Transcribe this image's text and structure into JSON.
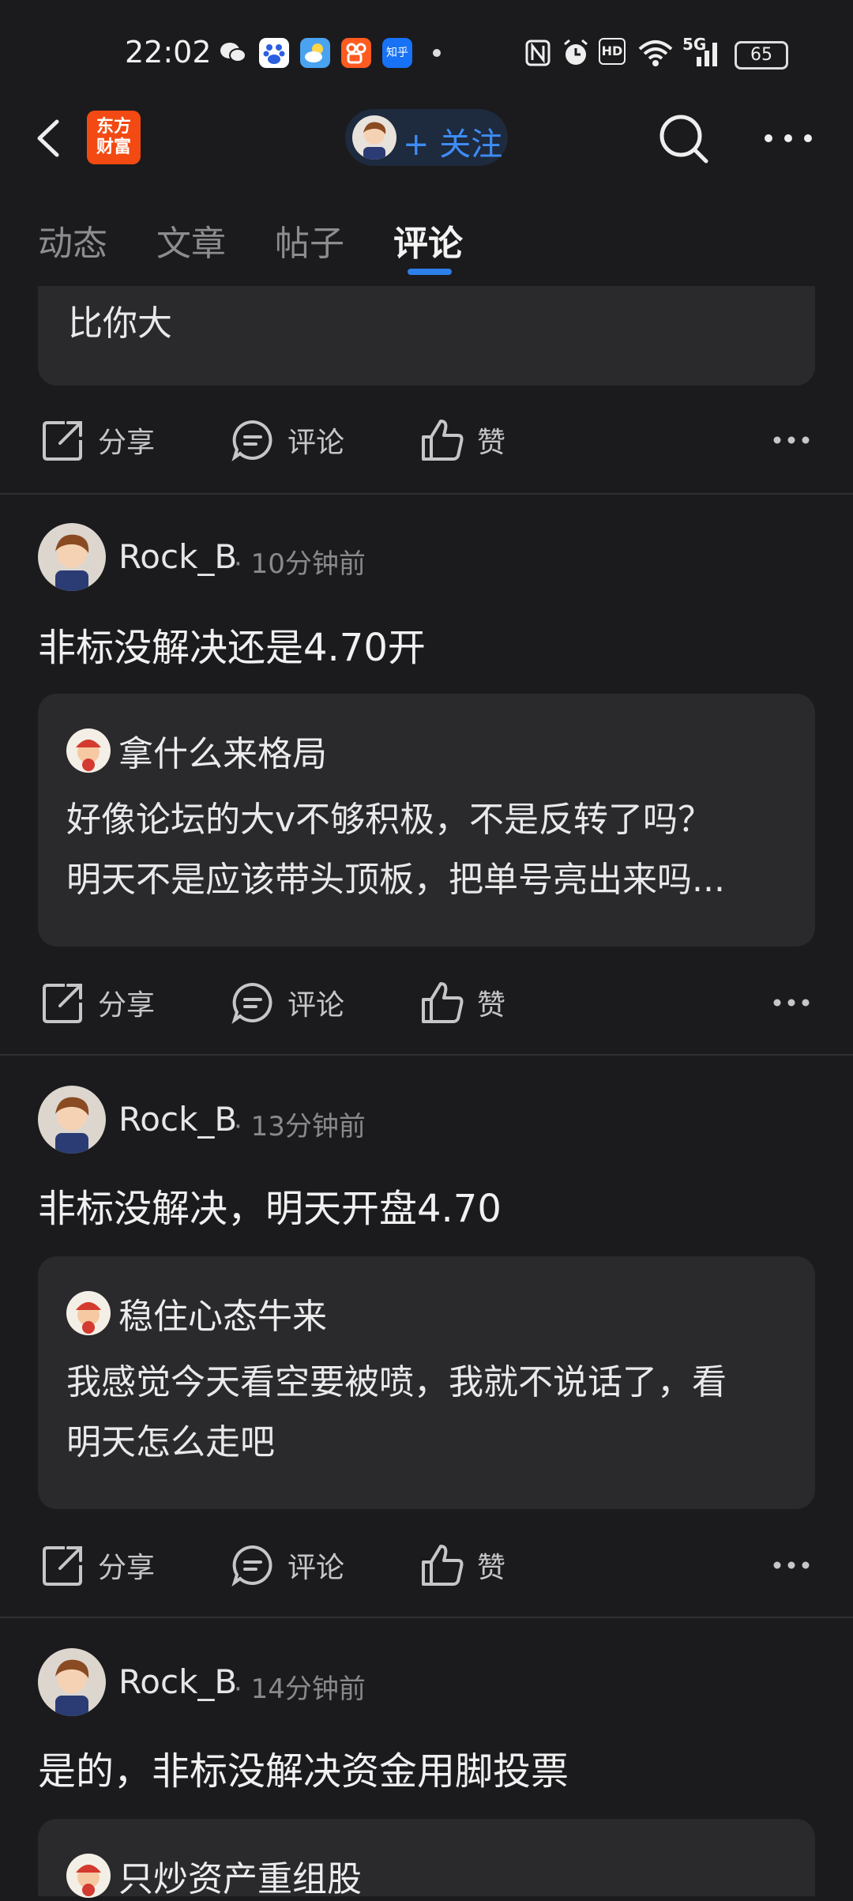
{
  "status_bar": {
    "time": "22:02",
    "battery": "65",
    "icons": [
      "wechat-icon",
      "baidu-icon",
      "weather-icon",
      "kuaishou-icon",
      "zhihu-icon",
      "nfc-icon",
      "alarm-icon",
      "hd-icon",
      "wifi-icon",
      "signal-5g-icon"
    ],
    "zhihu_label": "知乎",
    "hd_label": "HD",
    "net_label": "5G"
  },
  "header": {
    "logo_line1": "东方",
    "logo_line2": "财富",
    "follow_label": "+ 关注"
  },
  "tabs": [
    {
      "label": "动态"
    },
    {
      "label": "文章"
    },
    {
      "label": "帖子"
    },
    {
      "label": "评论"
    }
  ],
  "actions": {
    "share": "分享",
    "comment": "评论",
    "like": "赞"
  },
  "top_fragment": {
    "text": "比你大"
  },
  "posts": [
    {
      "author": "Rock_B",
      "time": "· 10分钟前",
      "text": "非标没解决还是4.70开",
      "quote_author": "拿什么来格局",
      "quote_line1": "好像论坛的大v不够积极，不是反转了吗？",
      "quote_line2": "明天不是应该带头顶板，把单号亮出来吗..."
    },
    {
      "author": "Rock_B",
      "time": "· 13分钟前",
      "text": "非标没解决，明天开盘4.70",
      "quote_author": "稳住心态牛来",
      "quote_line1": "我感觉今天看空要被喷，我就不说话了，看",
      "quote_line2": "明天怎么走吧"
    },
    {
      "author": "Rock_B",
      "time": "· 14分钟前",
      "text": "是的，非标没解决资金用脚投票",
      "quote_author": "只炒资产重组股"
    }
  ],
  "colors": {
    "background": "#1b1b1d",
    "card": "#2a2a2d",
    "accent": "#2d7fea",
    "follow": "#3e8cf5",
    "logo": "#f24a12"
  }
}
